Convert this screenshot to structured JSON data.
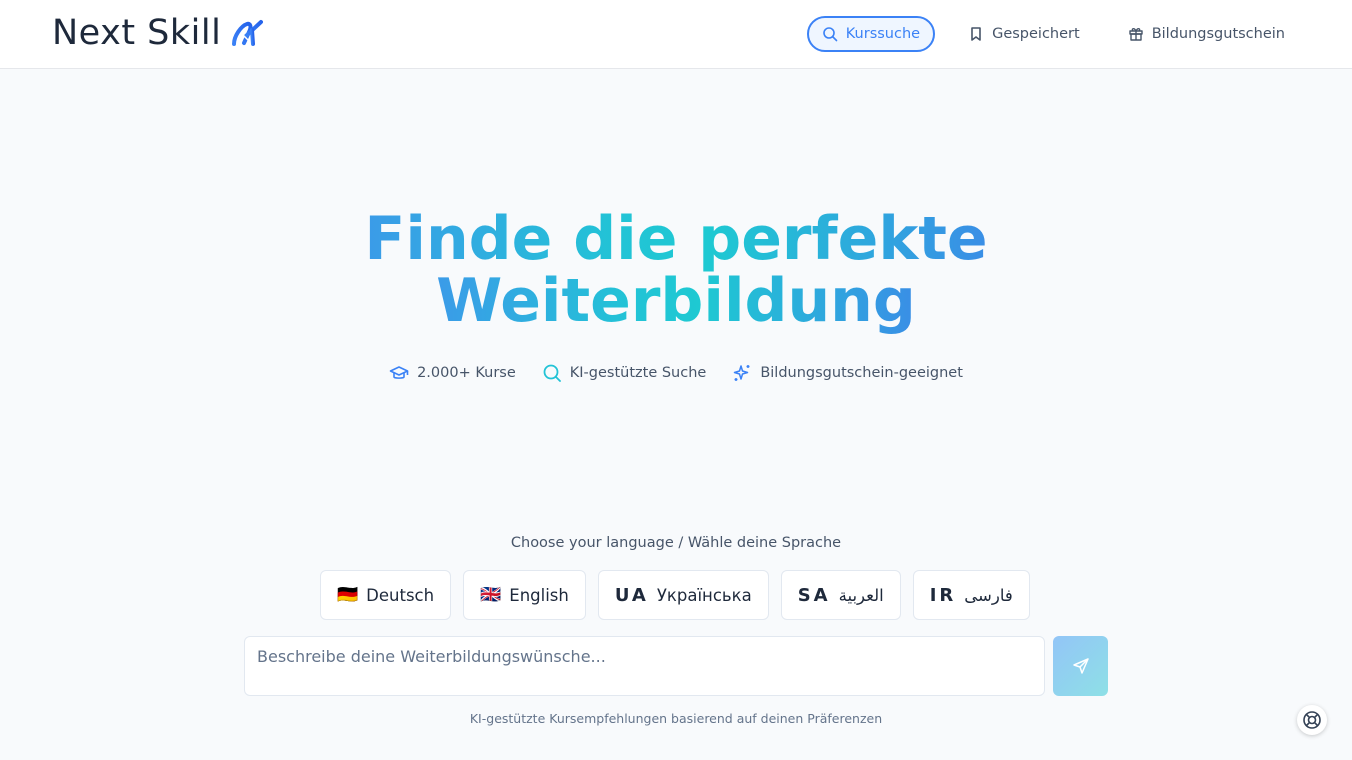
{
  "brand": {
    "name": "Next Skill",
    "accent": "#3b82f6",
    "gradient": [
      "#3b9be8",
      "#1ec9d2",
      "#3a8ee6"
    ]
  },
  "nav": {
    "items": [
      {
        "label": "Kurssuche",
        "icon": "search-icon",
        "active": true
      },
      {
        "label": "Gespeichert",
        "icon": "bookmark-icon",
        "active": false
      },
      {
        "label": "Bildungsgutschein",
        "icon": "gift-icon",
        "active": false
      }
    ]
  },
  "hero": {
    "title_line1": "Finde die perfekte",
    "title_line2": "Weiterbildung"
  },
  "features": [
    {
      "label": "2.000+ Kurse",
      "icon": "graduation-cap-icon"
    },
    {
      "label": "KI-gestützte Suche",
      "icon": "search-icon"
    },
    {
      "label": "Bildungsgutschein-geeignet",
      "icon": "sparkles-icon"
    }
  ],
  "language": {
    "label": "Choose your language / Wähle deine Sprache",
    "options": [
      {
        "flag": "🇩🇪",
        "code": "",
        "label": "Deutsch"
      },
      {
        "flag": "🇬🇧",
        "code": "",
        "label": "English"
      },
      {
        "flag": "",
        "code": "UA",
        "label": "Українська"
      },
      {
        "flag": "",
        "code": "SA",
        "label": "العربية"
      },
      {
        "flag": "",
        "code": "IR",
        "label": "فارسی"
      }
    ]
  },
  "prompt": {
    "placeholder": "Beschreibe deine Weiterbildungswünsche...",
    "value": "",
    "send_icon": "send-icon"
  },
  "hint": "KI-gestützte Kursempfehlungen basierend auf deinen Präferenzen",
  "help": {
    "icon": "life-buoy-icon"
  }
}
